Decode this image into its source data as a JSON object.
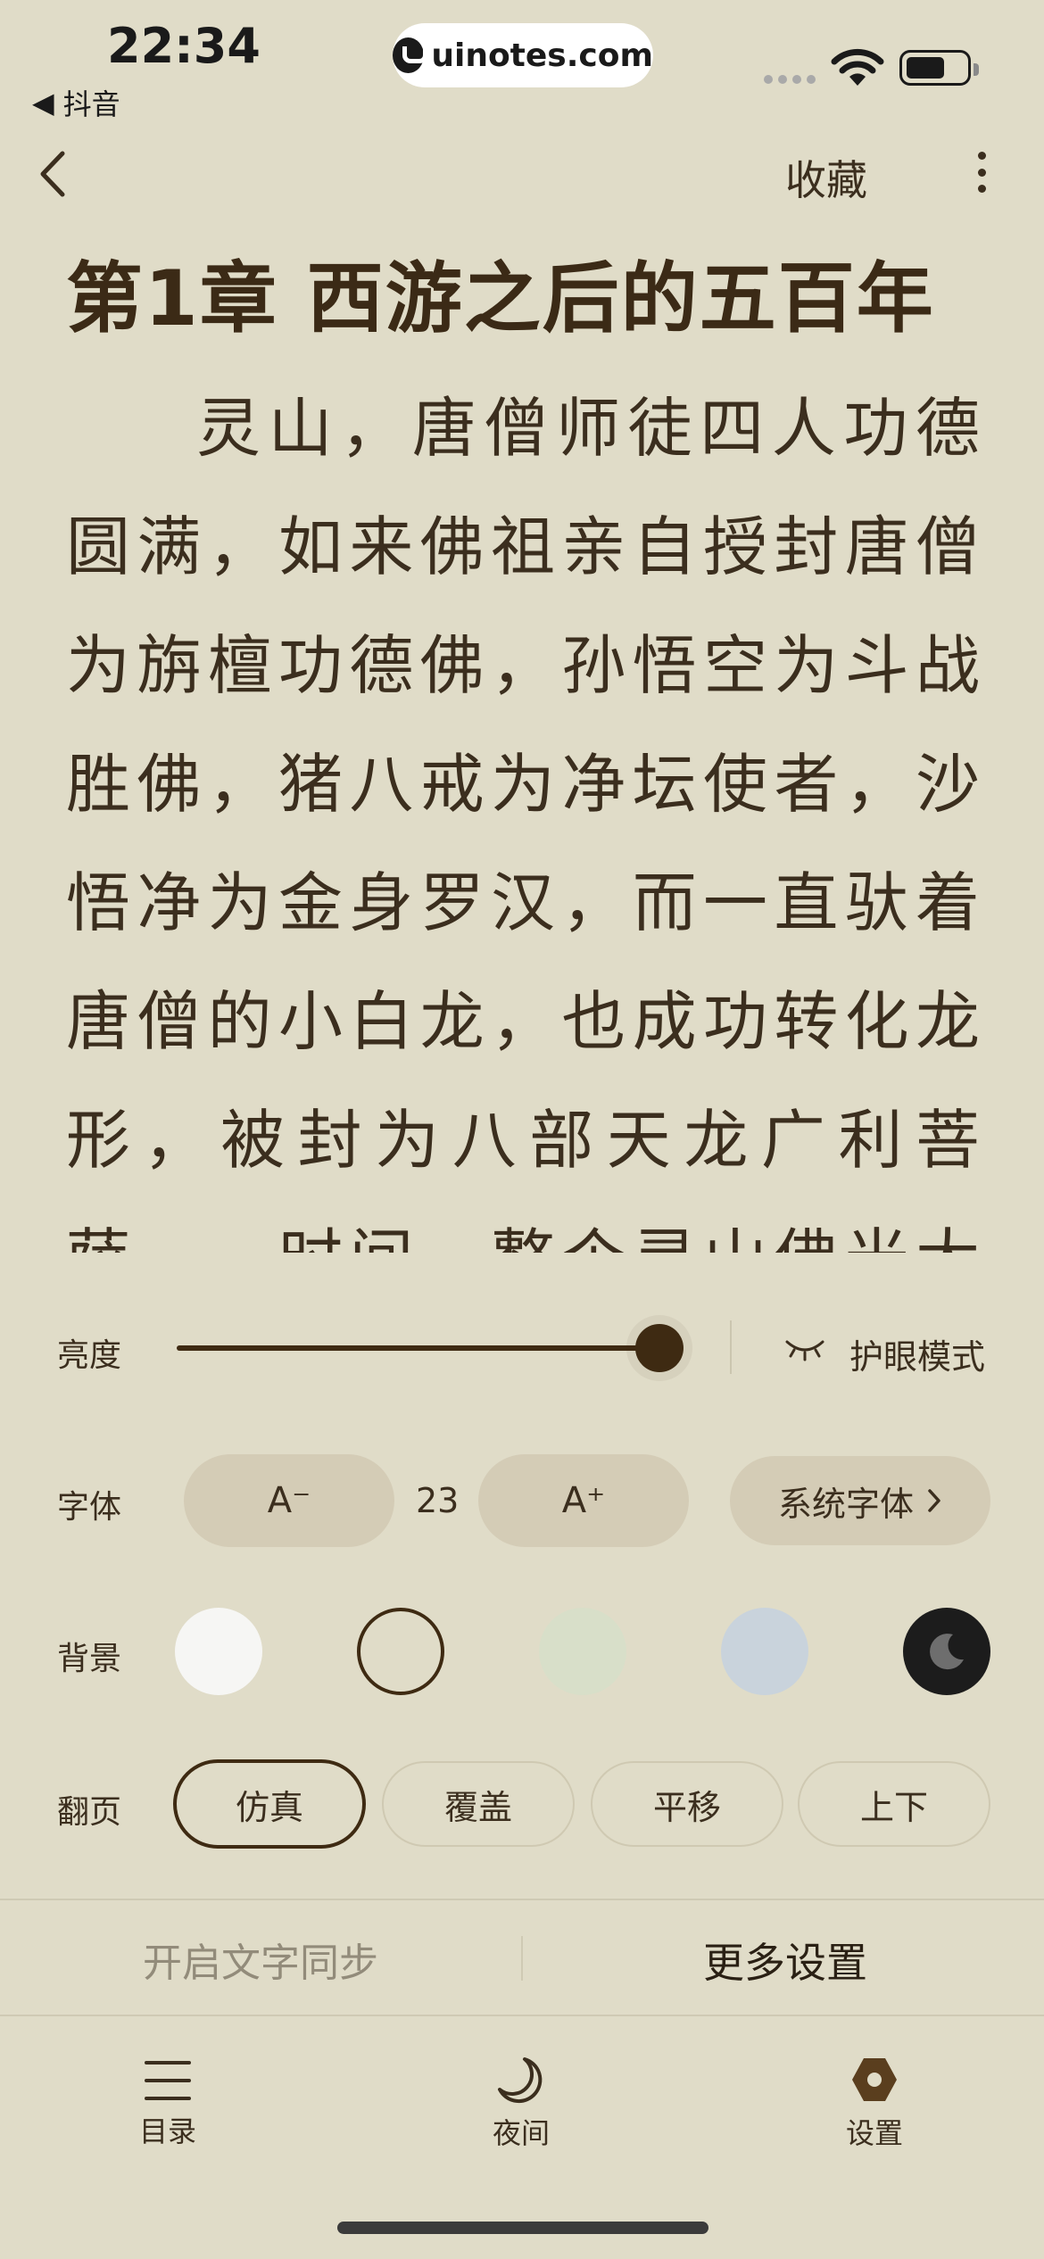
{
  "status_bar": {
    "time": "22:34",
    "back_app": "抖音",
    "url": "uinotes.com"
  },
  "nav": {
    "collect_label": "收藏"
  },
  "chapter": {
    "title": "第1章 西游之后的五百年",
    "body": "灵山，唐僧师徒四人功德圆满，如来佛祖亲自授封唐僧为旃檀功德佛，孙悟空为斗战胜佛，猪八戒为净坛使者，沙悟净为金身罗汉，而一直驮着唐僧的小白龙，也成功转化龙形，被封为八部天龙广利菩萨，一时间，整个灵山佛光大盛，金莲遍地"
  },
  "settings": {
    "brightness": {
      "label": "亮度",
      "value": 0.92,
      "eye_mode_label": "护眼模式"
    },
    "font": {
      "label": "字体",
      "decrease_label": "A⁻",
      "size": "23",
      "increase_label": "A⁺",
      "family_label": "系统字体"
    },
    "background": {
      "label": "背景",
      "swatches": [
        "#f6f6f4",
        "#e0dcc8",
        "#d8dfc9",
        "#c9d3dc",
        "#1c1c1c"
      ],
      "selected_index": 1
    },
    "page_turn": {
      "label": "翻页",
      "options": [
        "仿真",
        "覆盖",
        "平移",
        "上下"
      ],
      "selected": "仿真"
    },
    "sync_label": "开启文字同步",
    "more_settings_label": "更多设置"
  },
  "tabbar": {
    "items": [
      {
        "label": "目录",
        "icon": "list-icon"
      },
      {
        "label": "夜间",
        "icon": "moon-icon"
      },
      {
        "label": "设置",
        "icon": "hexagon-gear-icon"
      }
    ]
  }
}
